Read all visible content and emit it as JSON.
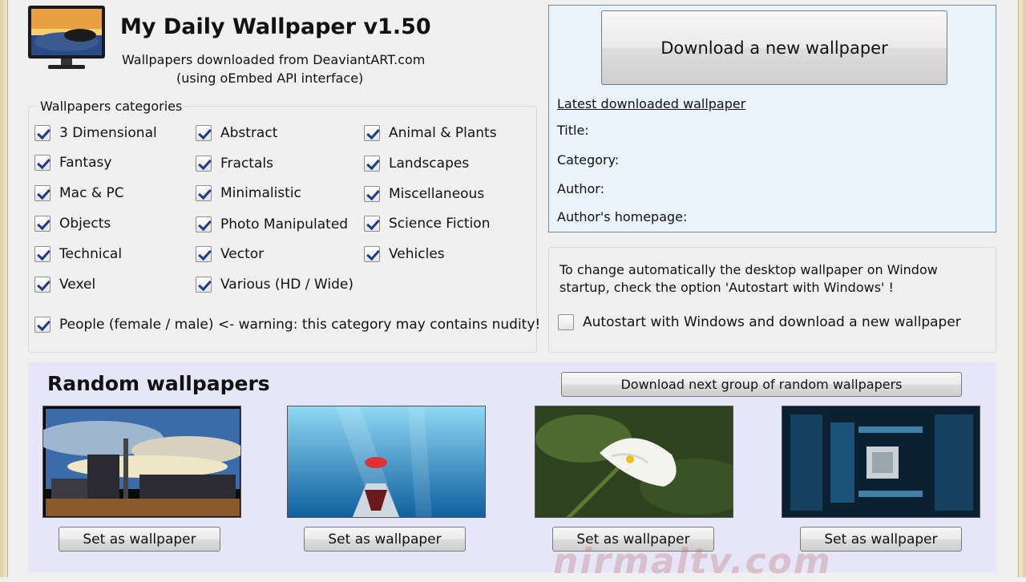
{
  "app": {
    "title": "My Daily Wallpaper v1.50",
    "subtitle_line1": "Wallpapers downloaded from DeaviantART.com",
    "subtitle_line2": "(using oEmbed API interface)"
  },
  "categories": {
    "legend": "Wallpapers categories",
    "items": [
      {
        "label": "3 Dimensional",
        "checked": true
      },
      {
        "label": "Abstract",
        "checked": true
      },
      {
        "label": "Animal & Plants",
        "checked": true
      },
      {
        "label": "Fantasy",
        "checked": true
      },
      {
        "label": "Fractals",
        "checked": true
      },
      {
        "label": "Landscapes",
        "checked": true
      },
      {
        "label": "Mac & PC",
        "checked": true
      },
      {
        "label": "Minimalistic",
        "checked": true
      },
      {
        "label": "Miscellaneous",
        "checked": true
      },
      {
        "label": "Objects",
        "checked": true
      },
      {
        "label": "Photo Manipulated",
        "checked": true
      },
      {
        "label": "Science Fiction",
        "checked": true
      },
      {
        "label": "Technical",
        "checked": true
      },
      {
        "label": "Vector",
        "checked": true
      },
      {
        "label": "Vehicles",
        "checked": true
      },
      {
        "label": "Vexel",
        "checked": true
      },
      {
        "label": "Various (HD / Wide)",
        "checked": true
      }
    ],
    "people": {
      "label": "People (female / male) <- warning: this category may contains nudity!",
      "checked": true
    }
  },
  "latest": {
    "download_button": "Download a new wallpaper",
    "heading": "Latest downloaded wallpaper",
    "title_label": "Title:",
    "category_label": "Category:",
    "author_label": "Author:",
    "homepage_label": "Author's homepage:"
  },
  "autostart": {
    "description": "To change automatically the desktop wallpaper on Window startup, check the option 'Autostart with Windows' !",
    "checkbox_label": "Autostart with Windows and download a new wallpaper",
    "checked": false
  },
  "random": {
    "title": "Random wallpapers",
    "next_button": "Download next group of random wallpapers",
    "set_button": "Set as wallpaper",
    "thumbnails": [
      "city-skyline-image",
      "underwater-shark-image",
      "calla-lily-image",
      "motherboard-image"
    ]
  },
  "watermark": "nirmaltv.com",
  "colors": {
    "info_panel_bg": "#eaf4fd",
    "random_panel_bg": "#e6e6f8",
    "check_mark": "#1e3a8a"
  }
}
